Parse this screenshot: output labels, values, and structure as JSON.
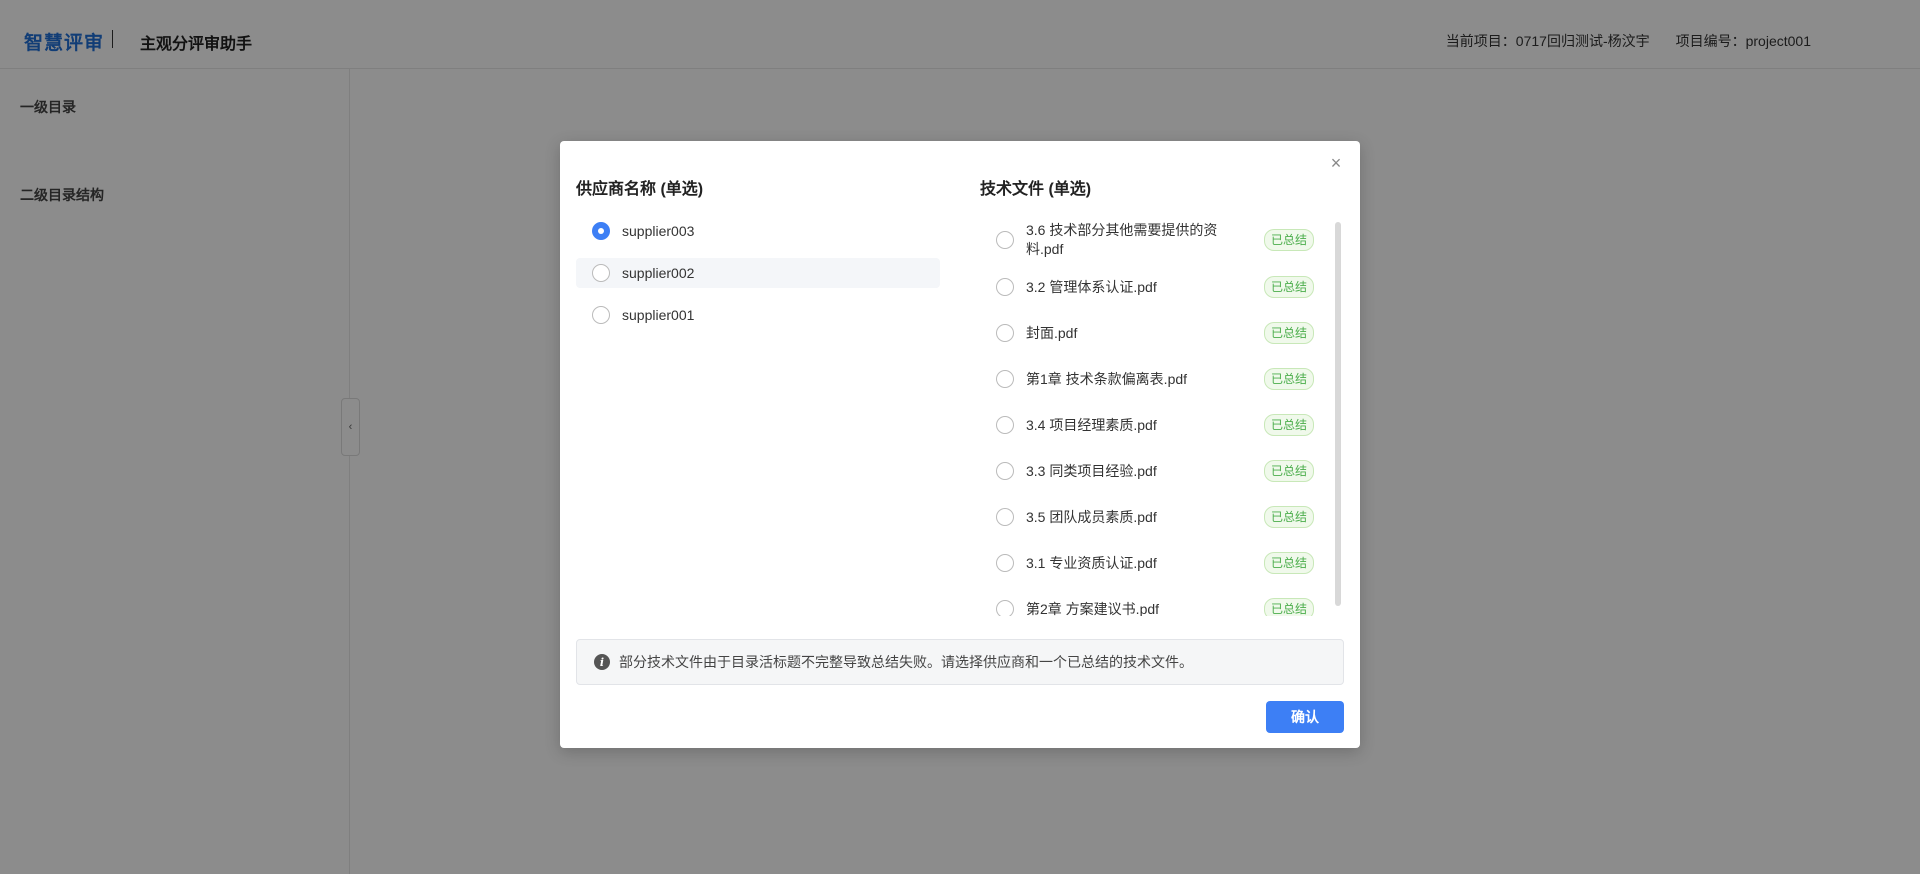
{
  "header": {
    "brand": "智慧评审",
    "title": "主观分评审助手",
    "current_project": "当前项目：0717回归测试-杨汶宇",
    "project_code": "项目编号：project001"
  },
  "sidebar": {
    "level1_label": "一级目录",
    "level2_label": "二级目录结构",
    "collapse_glyph": "‹"
  },
  "modal": {
    "close_glyph": "×",
    "supplier_title": "供应商名称 (单选)",
    "suppliers": [
      {
        "name": "supplier003",
        "selected": true
      },
      {
        "name": "supplier002",
        "selected": false
      },
      {
        "name": "supplier001",
        "selected": false
      }
    ],
    "file_title": "技术文件 (单选)",
    "files": [
      {
        "name": "3.6 技术部分其他需要提供的资料.pdf",
        "tag": "已总结"
      },
      {
        "name": "3.2 管理体系认证.pdf",
        "tag": "已总结"
      },
      {
        "name": "封面.pdf",
        "tag": "已总结"
      },
      {
        "name": "第1章 技术条款偏离表.pdf",
        "tag": "已总结"
      },
      {
        "name": "3.4 项目经理素质.pdf",
        "tag": "已总结"
      },
      {
        "name": "3.3 同类项目经验.pdf",
        "tag": "已总结"
      },
      {
        "name": "3.5 团队成员素质.pdf",
        "tag": "已总结"
      },
      {
        "name": "3.1 专业资质认证.pdf",
        "tag": "已总结"
      },
      {
        "name": "第2章 方案建议书.pdf",
        "tag": "已总结"
      }
    ],
    "notice_icon": "i",
    "notice": "部分技术文件由于目录活标题不完整导致总结失败。请选择供应商和一个已总结的技术文件。",
    "confirm_label": "确认"
  },
  "colors": {
    "brand": "#1f6fd8",
    "primary": "#3d7ff5",
    "tag_text": "#4cae4c",
    "tag_bg": "#f0f9eb"
  }
}
